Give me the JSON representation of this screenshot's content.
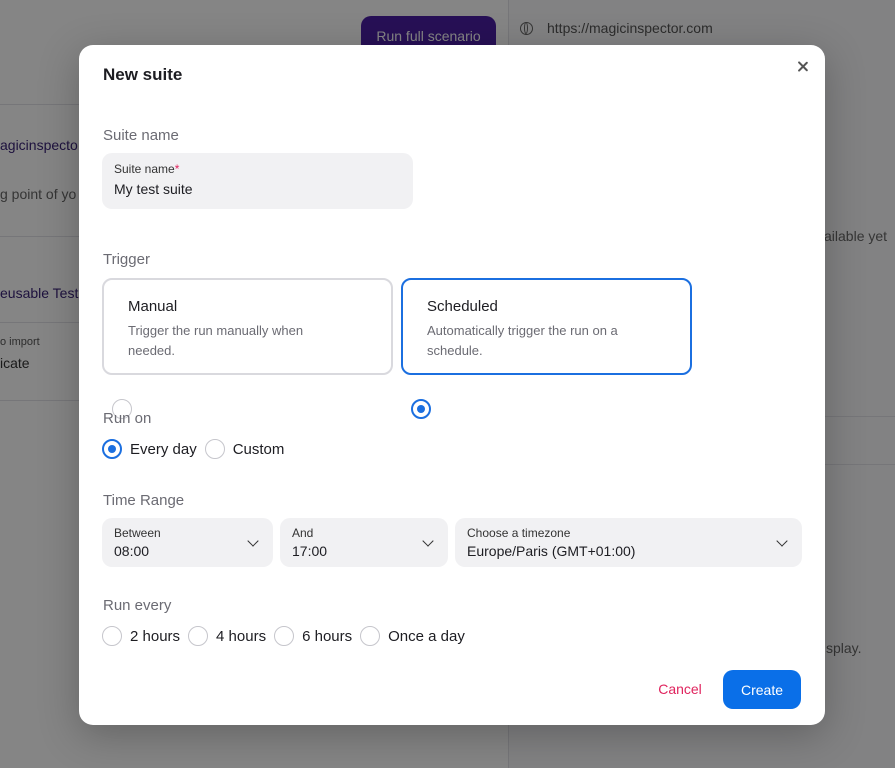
{
  "background": {
    "run_button_label": "Run full scenario",
    "url": "https://magicinspector.com",
    "fragments": {
      "site_name": "agicinspecto",
      "starting_point": "g point of yo",
      "reusable_tests": "eusable Test",
      "to_import": "o import",
      "duplicate": "icate",
      "available": "ailable yet",
      "display": "splay."
    }
  },
  "modal": {
    "title": "New suite",
    "suite_name_section": "Suite name",
    "suite_name_field": {
      "label": "Suite name",
      "required_mark": "*",
      "value": "My test suite"
    },
    "trigger_section": "Trigger",
    "trigger_options": [
      {
        "title": "Manual",
        "description": "Trigger the run manually when needed.",
        "selected": false
      },
      {
        "title": "Scheduled",
        "description": "Automatically trigger the run on a schedule.",
        "selected": true
      }
    ],
    "run_on_section": "Run on",
    "run_on_options": [
      {
        "label": "Every day",
        "selected": true
      },
      {
        "label": "Custom",
        "selected": false
      }
    ],
    "time_range_section": "Time Range",
    "between": {
      "label": "Between",
      "value": "08:00"
    },
    "and": {
      "label": "And",
      "value": "17:00"
    },
    "timezone": {
      "label": "Choose a timezone",
      "value": "Europe/Paris (GMT+01:00)"
    },
    "run_every_section": "Run every",
    "run_every_options": [
      {
        "label": "2 hours",
        "selected": false
      },
      {
        "label": "4 hours",
        "selected": false
      },
      {
        "label": "6 hours",
        "selected": false
      },
      {
        "label": "Once a day",
        "selected": false
      }
    ],
    "cancel_label": "Cancel",
    "create_label": "Create"
  },
  "colors": {
    "accent": "#1b6fe0",
    "primary_button": "#0a6fe8",
    "cancel": "#e0245e",
    "background_button": "#4b1fa6"
  }
}
